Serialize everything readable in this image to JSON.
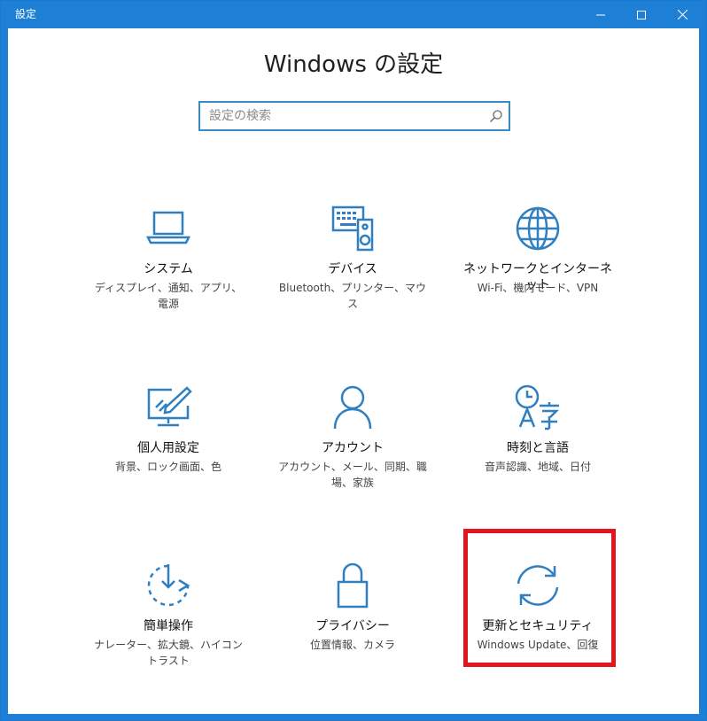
{
  "window": {
    "title": "設定"
  },
  "page": {
    "title": "Windows の設定"
  },
  "search": {
    "placeholder": "設定の検索"
  },
  "accent_color": "#1e7fd6",
  "highlight_color": "#e3161f",
  "tiles": [
    {
      "icon": "laptop-icon",
      "label": "システム",
      "desc": "ディスプレイ、通知、アプリ、電源"
    },
    {
      "icon": "devices-icon",
      "label": "デバイス",
      "desc": "Bluetooth、プリンター、マウス"
    },
    {
      "icon": "globe-icon",
      "label": "ネットワークとインターネット",
      "desc": "Wi-Fi、機内モード、VPN"
    },
    {
      "icon": "personalization-icon",
      "label": "個人用設定",
      "desc": "背景、ロック画面、色"
    },
    {
      "icon": "person-icon",
      "label": "アカウント",
      "desc": "アカウント、メール、同期、職場、家族"
    },
    {
      "icon": "time-language-icon",
      "label": "時刻と言語",
      "desc": "音声認識、地域、日付"
    },
    {
      "icon": "ease-of-access-icon",
      "label": "簡単操作",
      "desc": "ナレーター、拡大鏡、ハイコントラスト"
    },
    {
      "icon": "lock-icon",
      "label": "プライバシー",
      "desc": "位置情報、カメラ"
    },
    {
      "icon": "sync-icon",
      "label": "更新とセキュリティ",
      "desc": "Windows Update、回復"
    }
  ]
}
